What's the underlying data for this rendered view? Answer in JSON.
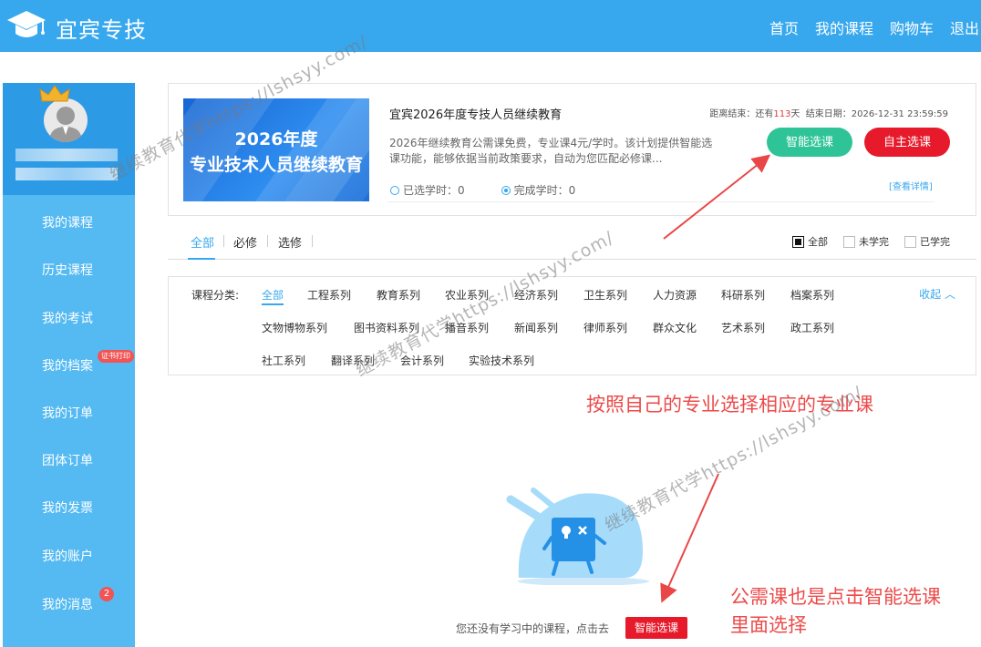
{
  "header": {
    "logo": "宜宾专技",
    "nav": [
      "首页",
      "我的课程",
      "购物车",
      "退出"
    ]
  },
  "sidebar": {
    "items": [
      "我的课程",
      "历史课程",
      "我的考试",
      "我的档案",
      "我的订单",
      "团体订单",
      "我的发票",
      "我的账户",
      "我的消息"
    ],
    "cert_badge": "证书打印",
    "message_count": "2"
  },
  "course": {
    "banner_line1": "2026年度",
    "banner_line2": "专业技术人员继续教育",
    "title": "宜宾2026年度专技人员继续教育",
    "deadline_prefix": "距离结束：还有",
    "days_left": "113",
    "days_unit": "天",
    "end_label": "结束日期：2026-12-31 23:59:59",
    "description": "2026年继续教育公需课免费，专业课4元/学时。该计划提供智能选课功能，能够依据当前政策要求，自动为您匹配必修课...",
    "smart_button": "智能选课",
    "self_button": "自主选课",
    "selected_hours": "已选学时：0",
    "completed_hours": "完成学时：0",
    "detail_link": "[查看详情]"
  },
  "tabs": {
    "items": [
      "全部",
      "必修",
      "选修"
    ],
    "filters": [
      "全部",
      "未学完",
      "已学完"
    ]
  },
  "categories": {
    "label": "课程分类:",
    "collapse": "收起",
    "rows": [
      [
        "全部",
        "工程系列",
        "教育系列",
        "农业系列",
        "经济系列",
        "卫生系列",
        "人力资源",
        "科研系列",
        "档案系列"
      ],
      [
        "文物博物系列",
        "图书资料系列",
        "播音系列",
        "新闻系列",
        "律师系列",
        "群众文化",
        "艺术系列",
        "政工系列"
      ],
      [
        "社工系列",
        "翻译系列",
        "会计系列",
        "实验技术系列"
      ]
    ]
  },
  "annotations": {
    "a1": "按照自己的专业选择相应的专业课",
    "a2_line1": "公需课也是点击智能选课",
    "a2_line2": "里面选择"
  },
  "empty": {
    "text": "您还没有学习中的课程，点击去",
    "button": "智能选课"
  },
  "watermark": "继续教育代学https://lshsyy.com/",
  "colors": {
    "header": "#38a8ee",
    "sidebar": "#55baf2",
    "green": "#2ec497",
    "red": "#e61a2b",
    "annotation": "#ec4a4a"
  }
}
